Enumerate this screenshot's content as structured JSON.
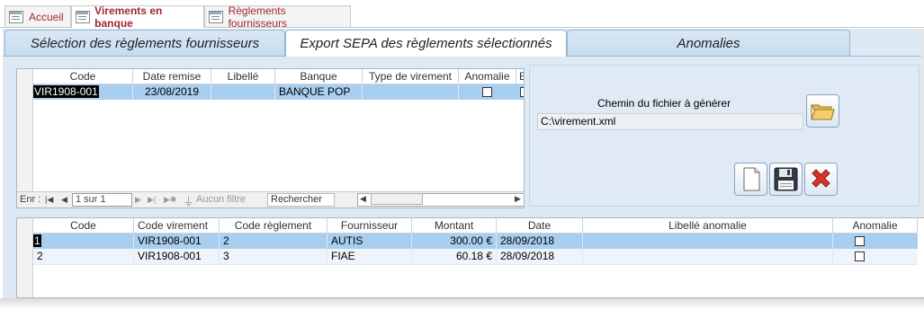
{
  "doc_tabs": [
    {
      "label": "Accueil",
      "active": false
    },
    {
      "label": "Virements en banque",
      "active": true
    },
    {
      "label": "Règlements fournisseurs",
      "active": false
    }
  ],
  "form_tabs": [
    {
      "label": "Sélection des règlements fournisseurs",
      "active": false
    },
    {
      "label": "Export SEPA des règlements sélectionnés",
      "active": true
    },
    {
      "label": "Anomalies",
      "active": false
    }
  ],
  "virements_grid": {
    "columns": [
      "Code",
      "Date remise",
      "Libellé",
      "Banque",
      "Type de virement",
      "Anomalie",
      "Ex"
    ],
    "rows": [
      {
        "code": "VIR1908-001",
        "date_remise": "23/08/2019",
        "libelle": "",
        "banque": "BANQUE POP",
        "type_virement": "",
        "anomalie": false
      }
    ],
    "nav": {
      "record_label": "Enr :",
      "first": "|◀",
      "prev": "◀",
      "position": "1 sur 1",
      "next": "▶",
      "last": "▶|",
      "new": "▶✱",
      "filter": "Aucun filtre",
      "search_placeholder": "Rechercher"
    }
  },
  "export_panel": {
    "path_label": "Chemin du fichier à générer",
    "path_value": "C:\\virement.xml",
    "browse_icon": "folder-icon",
    "new_icon": "blank-page-icon",
    "save_icon": "floppy-disk-icon",
    "cancel_icon": "red-x-icon"
  },
  "lines_grid": {
    "columns": [
      "Code",
      "Code virement",
      "Code règlement",
      "Fournisseur",
      "Montant",
      "Date",
      "Libellé anomalie",
      "Anomalie"
    ],
    "rows": [
      {
        "code": "1",
        "code_virement": "VIR1908-001",
        "code_reglement": "2",
        "fournisseur": "AUTIS",
        "montant": "300.00 €",
        "date": "28/09/2018",
        "libelle_anomalie": "",
        "anomalie": false
      },
      {
        "code": "2",
        "code_virement": "VIR1908-001",
        "code_reglement": "3",
        "fournisseur": "FIAE",
        "montant": "60.18 €",
        "date": "28/09/2018",
        "libelle_anomalie": "",
        "anomalie": false
      }
    ]
  },
  "colors": {
    "selection": "#a8cef0",
    "form_bg": "#ddeaf5",
    "tab_text": "#a02830"
  }
}
